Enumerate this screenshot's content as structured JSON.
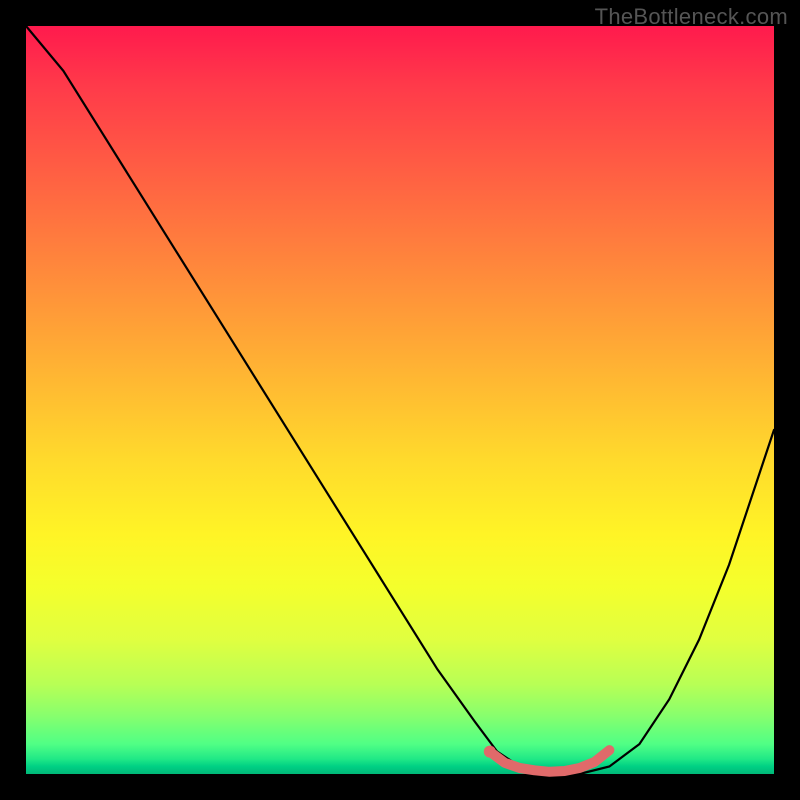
{
  "watermark": "TheBottleneck.com",
  "chart_data": {
    "type": "line",
    "title": "",
    "xlabel": "",
    "ylabel": "",
    "xlim": [
      0,
      100
    ],
    "ylim": [
      0,
      100
    ],
    "grid": false,
    "legend": false,
    "series": [
      {
        "name": "curve",
        "color": "#000000",
        "x": [
          0,
          5,
          10,
          15,
          20,
          25,
          30,
          35,
          40,
          45,
          50,
          55,
          60,
          63,
          66,
          70,
          74,
          78,
          82,
          86,
          90,
          94,
          100
        ],
        "y": [
          100,
          94,
          86,
          78,
          70,
          62,
          54,
          46,
          38,
          30,
          22,
          14,
          7,
          3,
          1,
          0,
          0,
          1,
          4,
          10,
          18,
          28,
          46
        ]
      },
      {
        "name": "highlight",
        "color": "#e06a6a",
        "x": [
          62,
          64,
          66,
          68,
          70,
          72,
          74,
          76,
          78
        ],
        "y": [
          3,
          1.5,
          0.8,
          0.5,
          0.3,
          0.4,
          0.8,
          1.6,
          3.2
        ]
      }
    ],
    "highlight_dot": {
      "x": 62,
      "y": 3,
      "color": "#e06a6a"
    },
    "background_gradient": {
      "top": "#ff1a4d",
      "mid": "#ffda2c",
      "bottom": "#00b878"
    }
  }
}
